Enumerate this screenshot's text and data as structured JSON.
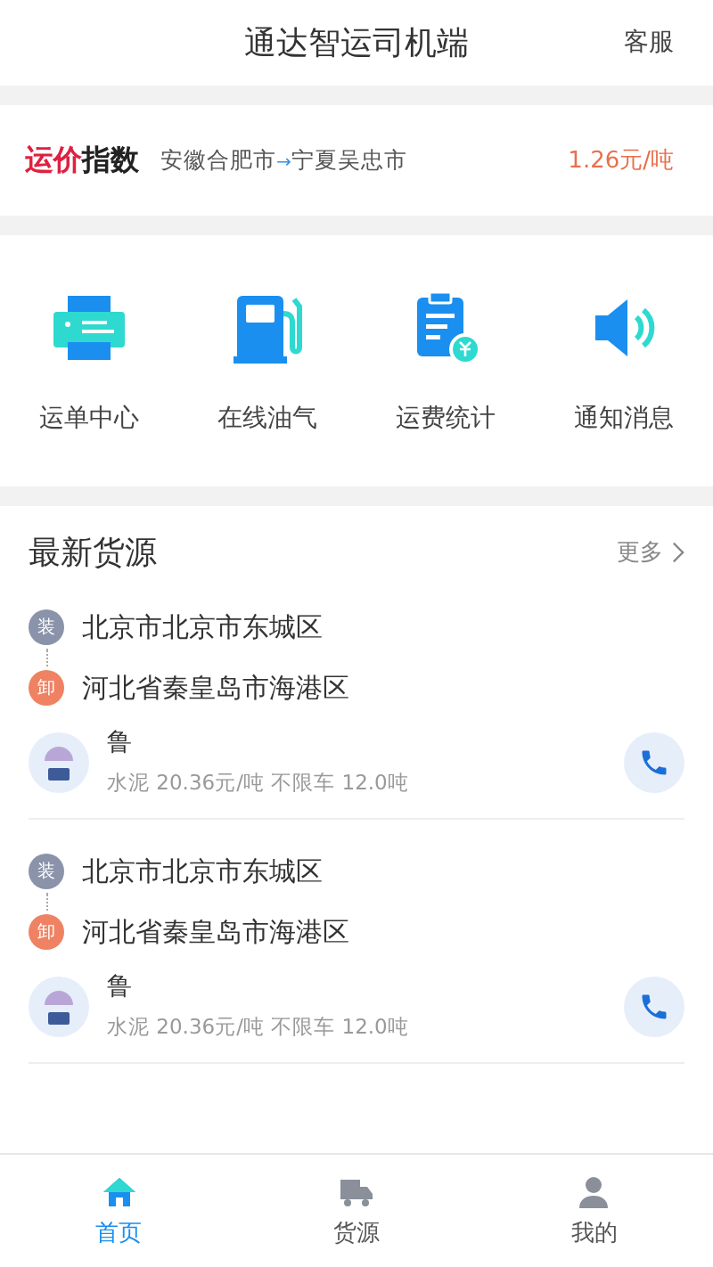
{
  "header": {
    "title": "通达智运司机端",
    "action": "客服"
  },
  "price_index": {
    "title_accent": "运价",
    "title_rest": "指数",
    "from": "安徽合肥市",
    "arrow": "→",
    "to": "宁夏吴忠市",
    "price": "1.26元/吨"
  },
  "shortcuts": [
    {
      "label": "运单中心",
      "kind": "printer"
    },
    {
      "label": "在线油气",
      "kind": "fuel"
    },
    {
      "label": "运费统计",
      "kind": "bill"
    },
    {
      "label": "通知消息",
      "kind": "speaker"
    }
  ],
  "cargo": {
    "title": "最新货源",
    "more": "更多",
    "items": [
      {
        "load_tag": "装",
        "load": "北京市北京市东城区",
        "unload_tag": "卸",
        "unload": "河北省秦皇岛市海港区",
        "name": "鲁",
        "detail": "水泥 20.36元/吨 不限车 12.0吨"
      },
      {
        "load_tag": "装",
        "load": "北京市北京市东城区",
        "unload_tag": "卸",
        "unload": "河北省秦皇岛市海港区",
        "name": "鲁",
        "detail": "水泥 20.36元/吨 不限车 12.0吨"
      }
    ]
  },
  "tabs": [
    {
      "label": "首页",
      "kind": "home",
      "selected": true
    },
    {
      "label": "货源",
      "kind": "truck",
      "selected": false
    },
    {
      "label": "我的",
      "kind": "user",
      "selected": false
    }
  ]
}
